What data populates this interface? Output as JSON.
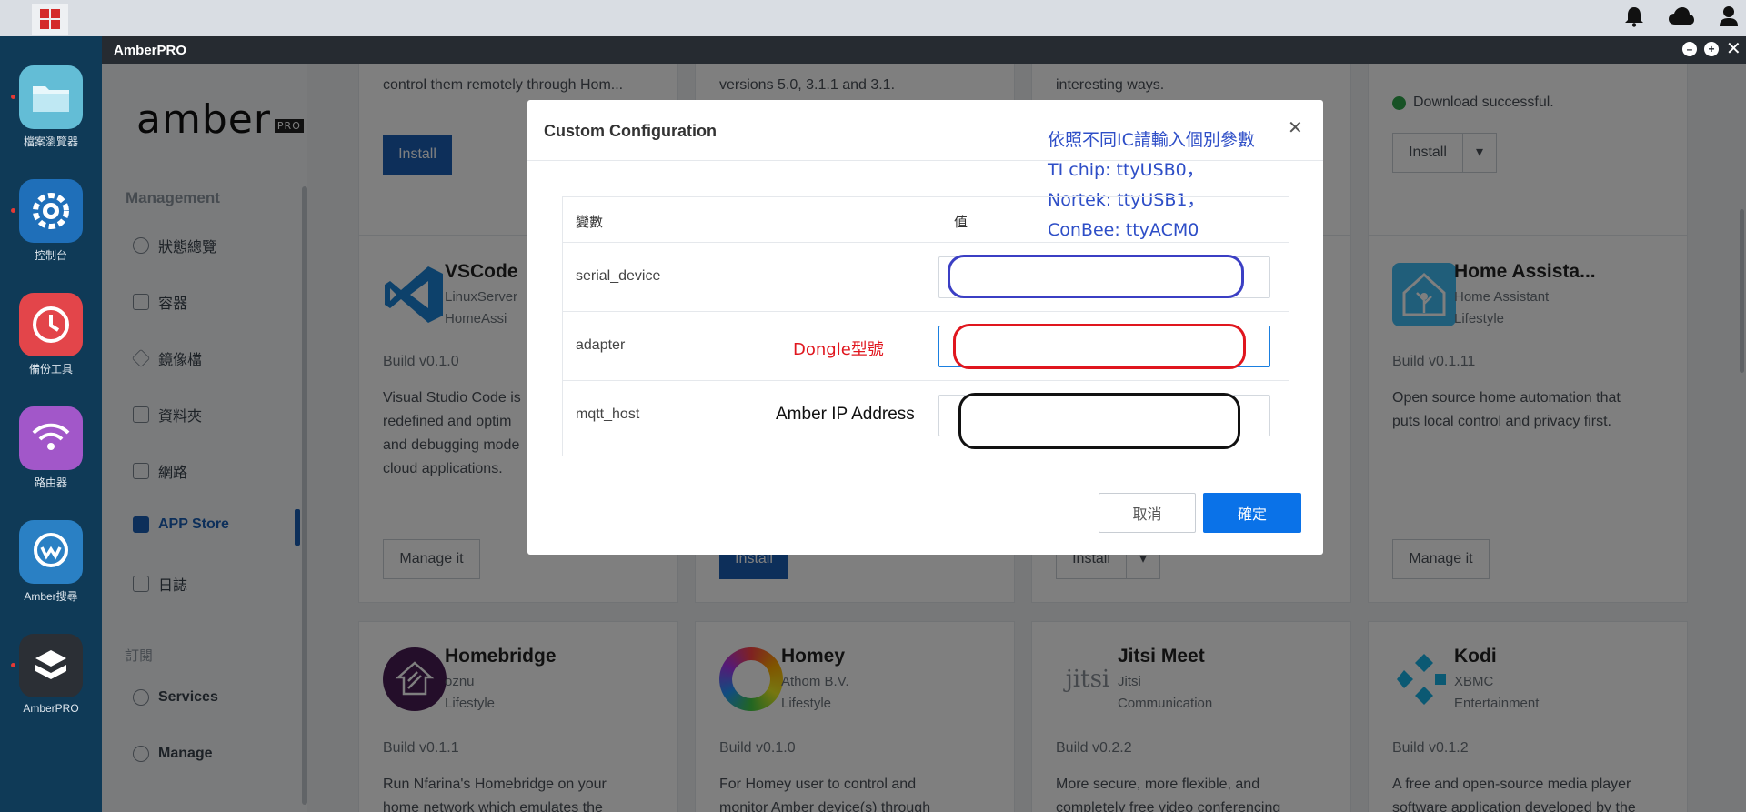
{
  "os": {
    "icons": [
      "bell-icon",
      "cloud-icon",
      "user-icon"
    ]
  },
  "dock": [
    {
      "label": "檔案瀏覽器",
      "icon": "folder-icon",
      "color": "#6cc3da"
    },
    {
      "label": "控制台",
      "icon": "gear-icon",
      "color": "#1f6fb9"
    },
    {
      "label": "備份工具",
      "icon": "clock-icon",
      "color": "#e3454a"
    },
    {
      "label": "路由器",
      "icon": "wifi-icon",
      "color": "#a257c9"
    },
    {
      "label": "Amber搜尋",
      "icon": "search-bubble-icon",
      "color": "#2a80c4"
    },
    {
      "label": "AmberPRO",
      "icon": "box-icon",
      "color": "#2b2f35"
    }
  ],
  "window": {
    "title": "AmberPRO"
  },
  "sidebar": {
    "logo": "amber",
    "logo_badge": "PRO",
    "section_management": "Management",
    "items": [
      {
        "label": "狀態總覽",
        "icon": "dashboard-icon"
      },
      {
        "label": "容器",
        "icon": "container-icon"
      },
      {
        "label": "鏡像檔",
        "icon": "layers-icon"
      },
      {
        "label": "資料夾",
        "icon": "folder-icon"
      },
      {
        "label": "網路",
        "icon": "network-icon"
      },
      {
        "label": "APP Store",
        "icon": "store-icon"
      },
      {
        "label": "日誌",
        "icon": "log-icon"
      }
    ],
    "section_subscribe": "訂閱",
    "sub_items": [
      {
        "label": "Services",
        "icon": "dollar-icon"
      },
      {
        "label": "Manage",
        "icon": "gear-icon"
      }
    ]
  },
  "cards_top": {
    "c1_text": "control them remotely through Hom...",
    "c1_button": "Install",
    "c2_text": "versions 5.0, 3.1.1 and 3.1.",
    "c3_text": "interesting ways.",
    "c4_status": "Download successful.",
    "c4_button": "Install"
  },
  "cards_mid": {
    "vscode": {
      "name": "VSCode",
      "publisher": "LinuxServer",
      "category": "HomeAssi",
      "build": "Build v0.1.0",
      "desc": [
        "Visual Studio Code is",
        "redefined and optim",
        "and debugging mode",
        "cloud applications."
      ],
      "button": "Manage it"
    },
    "c2_button": "Install",
    "c3_button": "Install",
    "homeassistant": {
      "name": "Home Assista...",
      "publisher": "Home Assistant",
      "category": "Lifestyle",
      "build": "Build v0.1.11",
      "desc": [
        "Open source home automation that",
        "puts local control and privacy first."
      ],
      "button": "Manage it"
    }
  },
  "cards_bottom": [
    {
      "name": "Homebridge",
      "publisher": "oznu",
      "category": "Lifestyle",
      "build": "Build v0.1.1",
      "desc": [
        "Run Nfarina's Homebridge on your",
        "home network which emulates the"
      ]
    },
    {
      "name": "Homey",
      "publisher": "Athom B.V.",
      "category": "Lifestyle",
      "build": "Build v0.1.0",
      "desc": [
        "For Homey user to control and",
        "monitor Amber device(s) through"
      ]
    },
    {
      "name": "Jitsi Meet",
      "publisher": "Jitsi",
      "category": "Communication",
      "build": "Build v0.2.2",
      "desc": [
        "More secure, more flexible, and",
        "completely free video conferencing"
      ],
      "logo_text": "jitsi"
    },
    {
      "name": "Kodi",
      "publisher": "XBMC",
      "category": "Entertainment",
      "build": "Build v0.1.2",
      "desc": [
        "A free and open-source media player",
        "software application developed by the"
      ]
    }
  ],
  "modal": {
    "title": "Custom Configuration",
    "col_var": "變數",
    "col_val": "值",
    "rows": [
      {
        "key": "serial_device",
        "value": ""
      },
      {
        "key": "adapter",
        "value": ""
      },
      {
        "key": "mqtt_host",
        "value": ""
      }
    ],
    "cancel": "取消",
    "ok": "確定"
  },
  "annotations": {
    "note": [
      "依照不同IC請輸入個別參數",
      "TI chip:  ttyUSB0，",
      "Nortek:  ttyUSB1，",
      "ConBee:  ttyACM0"
    ],
    "adapter_hint": "Dongle型號",
    "mqtt_hint": "Amber IP Address",
    "ring_colors": [
      "#3b3fc4",
      "#e0161e",
      "#111111"
    ]
  }
}
